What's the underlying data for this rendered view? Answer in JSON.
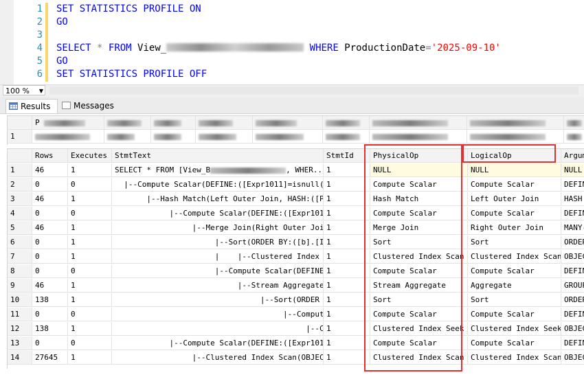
{
  "editor": {
    "lines": [
      {
        "num": "1",
        "text": "SET STATISTICS PROFILE ON"
      },
      {
        "num": "2",
        "text": "GO"
      },
      {
        "num": "3",
        "text": ""
      },
      {
        "num": "4",
        "select": "SELECT",
        "star": "*",
        "from": "FROM",
        "view": "View_",
        "where": "WHERE",
        "col": "ProductionDate",
        "eq": "=",
        "value": "'2025-09-10'"
      },
      {
        "num": "5",
        "text": "GO"
      },
      {
        "num": "6",
        "text": "SET STATISTICS PROFILE OFF"
      }
    ]
  },
  "zoom": {
    "value": "100 %"
  },
  "tabs": {
    "results": "Results",
    "messages": "Messages"
  },
  "grid1": {
    "row_num": "1",
    "first_header_fragment": "P"
  },
  "grid2": {
    "columns": [
      "Rows",
      "Executes",
      "StmtText",
      "StmtId",
      "PhysicalOp",
      "LogicalOp",
      "Argumen"
    ],
    "rows": [
      {
        "n": "1",
        "rows": "46",
        "exec": "1",
        "stmt": "SELECT * FROM [View_B",
        "stmt_tail": ", WHER...",
        "id": "1",
        "phys": "NULL",
        "log": "NULL",
        "arg": "NULL"
      },
      {
        "n": "2",
        "rows": "0",
        "exec": "0",
        "stmt": "  |--Compute Scalar(DEFINE:([Expr1011]=isnull(...",
        "id": "1",
        "phys": "Compute Scalar",
        "log": "Compute Scalar",
        "arg": "DEFINE"
      },
      {
        "n": "3",
        "rows": "46",
        "exec": "1",
        "stmt": "       |--Hash Match(Left Outer Join, HASH:([P...",
        "id": "1",
        "phys": "Hash Match",
        "log": "Left Outer Join",
        "arg": "HASH:("
      },
      {
        "n": "4",
        "rows": "0",
        "exec": "0",
        "stmt": "            |--Compute Scalar(DEFINE:([Expr101...",
        "id": "1",
        "phys": "Compute Scalar",
        "log": "Compute Scalar",
        "arg": "DEFINE"
      },
      {
        "n": "5",
        "rows": "46",
        "exec": "1",
        "stmt": "                 |--Merge Join(Right Outer Joi...",
        "id": "1",
        "phys": "Merge Join",
        "log": "Right Outer Join",
        "arg": "MANY-T"
      },
      {
        "n": "6",
        "rows": "0",
        "exec": "1",
        "stmt": "                      |--Sort(ORDER BY:([b].[I...",
        "id": "1",
        "phys": "Sort",
        "log": "Sort",
        "arg": "ORDER"
      },
      {
        "n": "7",
        "rows": "0",
        "exec": "1",
        "stmt": "                      |    |--Clustered Index ...",
        "id": "1",
        "phys": "Clustered Index Scan",
        "log": "Clustered Index Scan",
        "arg": "OBJECT"
      },
      {
        "n": "8",
        "rows": "0",
        "exec": "0",
        "stmt": "                      |--Compute Scalar(DEFINE...",
        "id": "1",
        "phys": "Compute Scalar",
        "log": "Compute Scalar",
        "arg": "DEFINE"
      },
      {
        "n": "9",
        "rows": "46",
        "exec": "1",
        "stmt": "                           |--Stream Aggregate...",
        "id": "1",
        "phys": "Stream Aggregate",
        "log": "Aggregate",
        "arg": "GROUP"
      },
      {
        "n": "10",
        "rows": "138",
        "exec": "1",
        "stmt": "                                |--Sort(ORDER ...",
        "id": "1",
        "phys": "Sort",
        "log": "Sort",
        "arg": "ORDER"
      },
      {
        "n": "11",
        "rows": "0",
        "exec": "0",
        "stmt": "                                     |--Comput...",
        "id": "1",
        "phys": "Compute Scalar",
        "log": "Compute Scalar",
        "arg": "DEFINE"
      },
      {
        "n": "12",
        "rows": "138",
        "exec": "1",
        "stmt": "                                          |--C...",
        "id": "1",
        "phys": "Clustered Index Seek",
        "log": "Clustered Index Seek",
        "arg": "OBJECT"
      },
      {
        "n": "13",
        "rows": "0",
        "exec": "0",
        "stmt": "            |--Compute Scalar(DEFINE:([Expr101...",
        "id": "1",
        "phys": "Compute Scalar",
        "log": "Compute Scalar",
        "arg": "DEFINE"
      },
      {
        "n": "14",
        "rows": "27645",
        "exec": "1",
        "stmt": "                 |--Clustered Index Scan(OBJEC...",
        "id": "1",
        "phys": "Clustered Index Scan",
        "log": "Clustered Index Scan",
        "arg": "OBJECT"
      }
    ]
  },
  "colors": {
    "keyword": "#0000ff",
    "string": "#ff0000",
    "line_number": "#2b91af",
    "highlight_box": "#e03030"
  }
}
